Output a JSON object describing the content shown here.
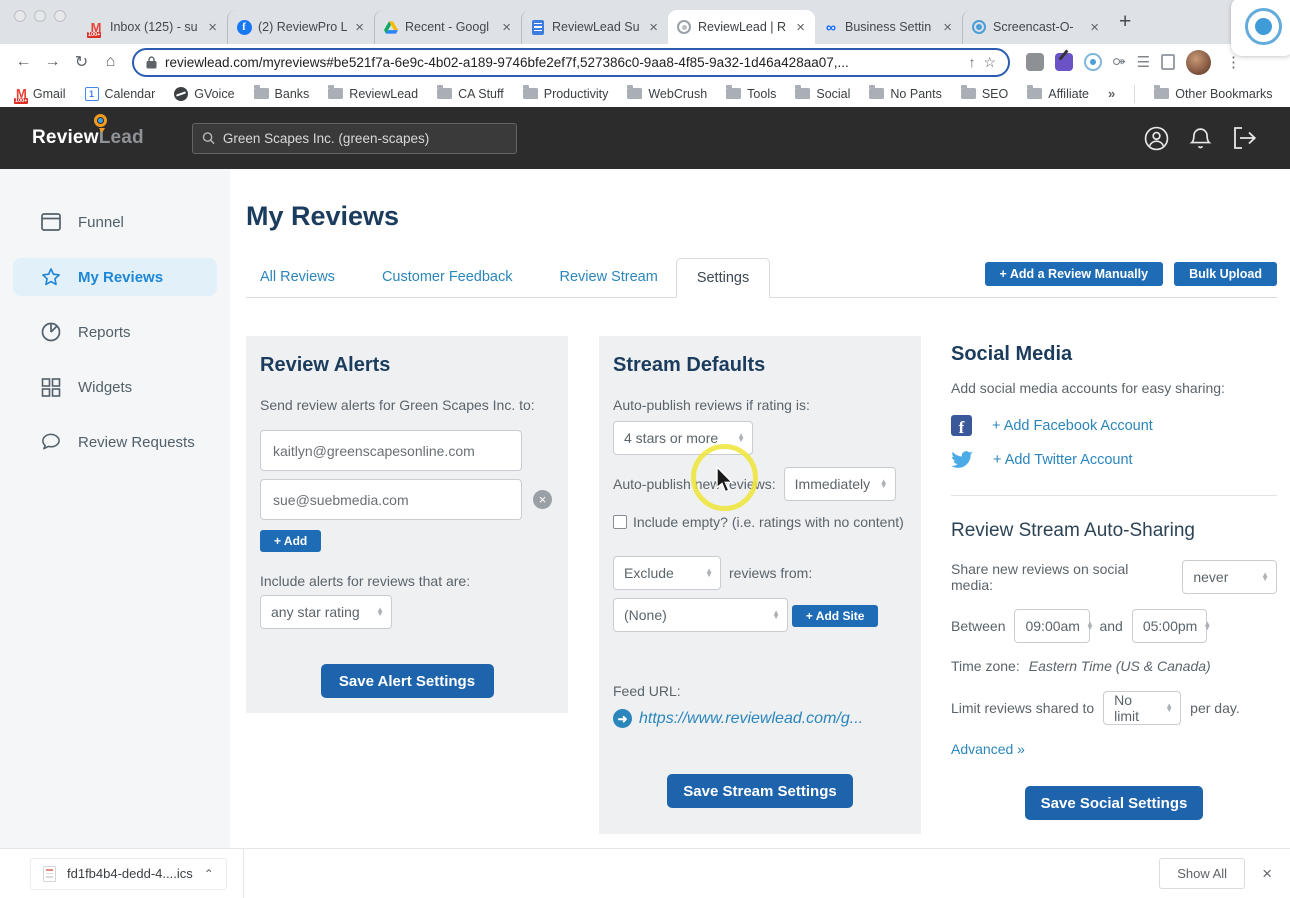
{
  "icons": {
    "close": "×",
    "new_tab": "+",
    "back": "←",
    "forward": "→",
    "reload": "↻",
    "home": "⌂",
    "star_outline": "☆",
    "menu_dots": "⋮",
    "share_arrow": "↑",
    "chevron_up": "⌃",
    "overflow": "»",
    "meta_infinity": "∞",
    "facebook_f": "f",
    "gmail_m": "M",
    "gmail_badge": "100+",
    "calendar_day": "1",
    "feed_arrow": "➜",
    "puzzle": "⚩",
    "list": "☰"
  },
  "browser": {
    "tabs": [
      {
        "label": "Inbox (125) - su"
      },
      {
        "label": "(2) ReviewPro L"
      },
      {
        "label": "Recent - Googl"
      },
      {
        "label": "ReviewLead Su"
      },
      {
        "label": "ReviewLead | R"
      },
      {
        "label": "Business Settin"
      },
      {
        "label": "Screencast-O-"
      }
    ],
    "url": "reviewlead.com/myreviews#be521f7a-6e9c-4b02-a189-9746bfe2ef7f,527386c0-9aa8-4f85-9a32-1d46a428aa07,...",
    "bookmarks": [
      "Gmail",
      "Calendar",
      "GVoice",
      "Banks",
      "ReviewLead",
      "CA Stuff",
      "Productivity",
      "WebCrush",
      "Tools",
      "Social",
      "No Pants",
      "SEO",
      "Affiliate"
    ],
    "other_bookmarks_label": "Other Bookmarks"
  },
  "app_header": {
    "logo_part1": "Review",
    "logo_part2": "Lead",
    "search_value": "Green Scapes Inc. (green-scapes)"
  },
  "sidebar": {
    "items": [
      {
        "label": "Funnel"
      },
      {
        "label": "My Reviews"
      },
      {
        "label": "Reports"
      },
      {
        "label": "Widgets"
      },
      {
        "label": "Review Requests"
      }
    ]
  },
  "main": {
    "title": "My Reviews",
    "tabs": [
      "All Reviews",
      "Customer Feedback",
      "Review Stream",
      "Settings"
    ],
    "add_review_button": "+ Add a Review Manually",
    "bulk_upload_button": "Bulk Upload"
  },
  "review_alerts": {
    "title": "Review Alerts",
    "description": "Send review alerts for Green Scapes Inc. to:",
    "emails": [
      "kaitlyn@greenscapesonline.com",
      "sue@suebmedia.com"
    ],
    "add_button": "+ Add",
    "include_label": "Include alerts for reviews that are:",
    "rating_value": "any star rating",
    "save_button": "Save Alert Settings"
  },
  "stream_defaults": {
    "title": "Stream Defaults",
    "autopublish_rating_label": "Auto-publish reviews if rating is:",
    "rating_value": "4 stars or more",
    "autopublish_new_label": "Auto-publish new reviews:",
    "when_value": "Immediately",
    "include_empty_label": "Include empty? (i.e. ratings with no content)",
    "exclude_value": "Exclude",
    "reviews_from_label": "reviews from:",
    "site_value": "(None)",
    "add_site_button": "+ Add Site",
    "feed_url_label": "Feed URL:",
    "feed_url": "https://www.reviewlead.com/g...",
    "save_button": "Save Stream Settings"
  },
  "social_media": {
    "title": "Social Media",
    "description": "Add social media accounts for easy sharing:",
    "facebook_link": "+ Add Facebook Account",
    "twitter_link": "+ Add Twitter Account"
  },
  "auto_sharing": {
    "title": "Review Stream Auto-Sharing",
    "share_label": "Share new reviews on social media:",
    "share_value": "never",
    "between_label": "Between",
    "start_time": "09:00am",
    "and_label": "and",
    "end_time": "05:00pm",
    "timezone_label": "Time zone:",
    "timezone_value": "Eastern Time (US & Canada)",
    "limit_label": "Limit reviews shared to",
    "limit_value": "No limit",
    "per_day_label": "per day.",
    "advanced_link": "Advanced »",
    "save_button": "Save Social Settings"
  },
  "download_bar": {
    "file_name": "fd1fb4b4-dedd-4....ics",
    "show_all_button": "Show All"
  }
}
